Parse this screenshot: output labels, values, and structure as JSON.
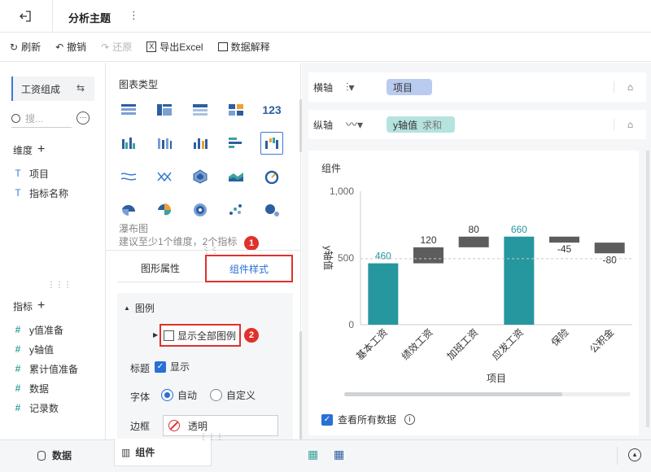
{
  "header": {
    "title": "分析主题"
  },
  "toolbar": {
    "refresh": "刷新",
    "undo": "撤销",
    "redo": "还原",
    "export": "导出Excel",
    "explain": "数据解释"
  },
  "left": {
    "table_name": "工资组成",
    "search_placeholder": "搜...",
    "dim_title": "维度",
    "dims": [
      "项目",
      "指标名称"
    ],
    "measure_title": "指标",
    "measures": [
      "y值准备",
      "y轴值",
      "累计值准备",
      "数据",
      "记录数"
    ]
  },
  "middle": {
    "chart_type_title": "图表类型",
    "chart_name": "瀑布图",
    "chart_hint": "建议至少1个维度，2个指标",
    "tabs": [
      "图形属性",
      "组件样式"
    ],
    "legend_section": "图例",
    "show_all_legend": "显示全部图例",
    "title_label": "标题",
    "title_show": "显示",
    "font_label": "字体",
    "font_auto": "自动",
    "font_custom": "自定义",
    "border_label": "边框",
    "border_value": "透明",
    "markers": [
      "1",
      "2"
    ]
  },
  "axes": {
    "x_label": "横轴",
    "x_field": "项目",
    "y_label": "纵轴",
    "y_field": "y轴值",
    "y_agg": "求和"
  },
  "chart_title": "组件",
  "chart_data": {
    "type": "waterfall",
    "categories": [
      "基本工资",
      "绩效工资",
      "加班工资",
      "应发工资",
      "保险",
      "公积金"
    ],
    "values": [
      460,
      120,
      80,
      660,
      -45,
      -80
    ],
    "data_labels": [
      "460",
      "120",
      "80",
      "660",
      "-45",
      "-80"
    ],
    "xlabel": "项目",
    "ylabel": "y轴值",
    "y_ticks": [
      "1,000",
      "500",
      "0"
    ],
    "ylim": [
      0,
      1000
    ],
    "colors": {
      "total": "#26979f",
      "delta": "#5d5d5d"
    }
  },
  "view_all": "查看所有数据",
  "bottom": {
    "data_tab": "数据",
    "component_tab": "组件"
  }
}
